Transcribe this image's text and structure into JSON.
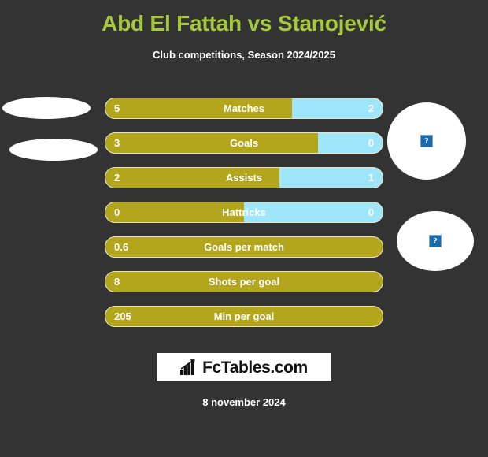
{
  "header": {
    "title": "Abd El Fattah vs Stanojević",
    "subtitle": "Club competitions, Season 2024/2025",
    "title_color": "#A6C83C",
    "subtitle_color": "#ffffff"
  },
  "colors": {
    "background": "#333333",
    "home_bar": "#B3A51C",
    "away_bar": "#A0E6FA",
    "bar_border": "#e9e4bf",
    "value_text": "#ffffff",
    "broken_image_icon": "#1a6bab"
  },
  "badges": {
    "left": [
      {
        "name": "home-player-photo",
        "shape": "ellipse",
        "state": "missing-image"
      },
      {
        "name": "home-club-logo",
        "shape": "ellipse",
        "state": "missing-image"
      }
    ],
    "right": [
      {
        "name": "away-player-photo",
        "shape": "circle",
        "state": "missing-image",
        "glyph": "?"
      },
      {
        "name": "away-club-logo",
        "shape": "circle",
        "state": "missing-image",
        "glyph": "?"
      }
    ]
  },
  "stats": [
    {
      "label": "Matches",
      "home": "5",
      "away": "2",
      "home_pct": 67.2,
      "split": true
    },
    {
      "label": "Goals",
      "home": "3",
      "away": "0",
      "home_pct": 76.8,
      "split": true
    },
    {
      "label": "Assists",
      "home": "2",
      "away": "1",
      "home_pct": 62.7,
      "split": true
    },
    {
      "label": "Hattricks",
      "home": "0",
      "away": "0",
      "home_pct": 50.0,
      "split": true
    },
    {
      "label": "Goals per match",
      "home": "0.6",
      "away": "",
      "home_pct": 100,
      "split": false
    },
    {
      "label": "Shots per goal",
      "home": "8",
      "away": "",
      "home_pct": 100,
      "split": false
    },
    {
      "label": "Min per goal",
      "home": "205",
      "away": "",
      "home_pct": 100,
      "split": false
    }
  ],
  "chart_data": {
    "type": "bar",
    "title": "Abd El Fattah vs Stanojević",
    "subtitle": "Club competitions, Season 2024/2025",
    "categories": [
      "Matches",
      "Goals",
      "Assists",
      "Hattricks",
      "Goals per match",
      "Shots per goal",
      "Min per goal"
    ],
    "series": [
      {
        "name": "Abd El Fattah",
        "values": [
          5,
          3,
          2,
          0,
          0.6,
          8,
          205
        ],
        "color": "#B3A51C"
      },
      {
        "name": "Stanojević",
        "values": [
          2,
          0,
          1,
          0,
          null,
          null,
          null
        ],
        "color": "#A0E6FA"
      }
    ],
    "orientation": "horizontal-stacked",
    "grid": false,
    "legend": "none"
  },
  "footer": {
    "logo_text": "FcTables.com",
    "logo_icon": "bar-chart-arrow-icon",
    "date": "8 november 2024"
  }
}
